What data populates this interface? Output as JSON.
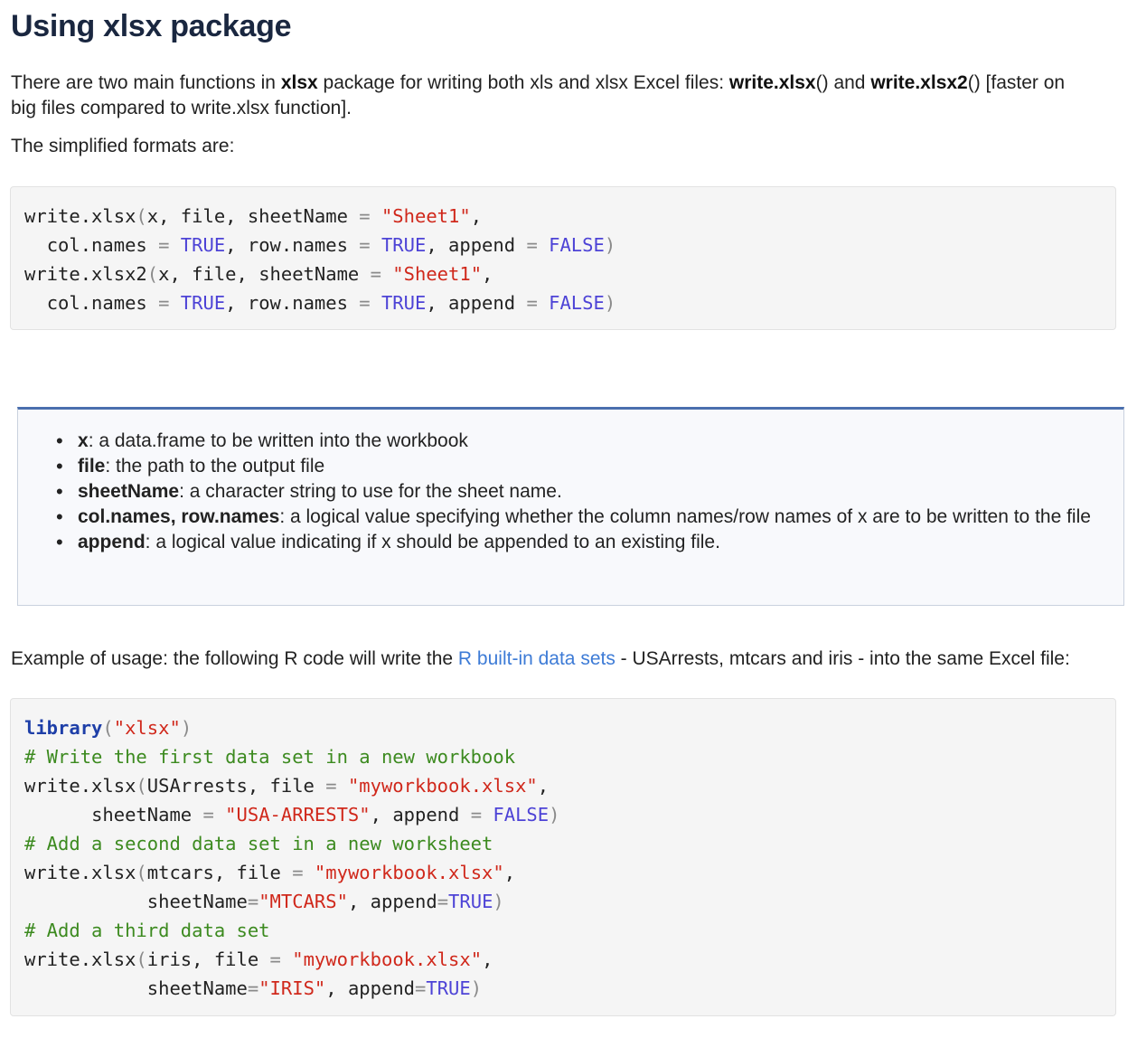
{
  "heading": "Using xlsx package",
  "intro": {
    "t1": "There are two main functions in ",
    "b1": "xlsx",
    "t2": " package for writing both xls and xlsx Excel files: ",
    "b2": "write.xlsx",
    "t3": "() and ",
    "b3": "write.xlsx2",
    "t4": "() [faster on",
    "line2": "big files compared to write.xlsx function]."
  },
  "simplified": "The simplified formats are:",
  "code1": {
    "fn1": "write.xlsx",
    "fn2": "write.xlsx2",
    "args_a": "x, file, sheetName ",
    "sheet1": "\"Sheet1\"",
    "col_names": "col.names ",
    "row_names": "row.names ",
    "append": "append ",
    "true": "TRUE",
    "false": "FALSE"
  },
  "args": [
    {
      "name": "x",
      "desc": ": a data.frame to be written into the workbook"
    },
    {
      "name": "file",
      "desc": ": the path to the output file"
    },
    {
      "name": "sheetName",
      "desc": ": a character string to use for the sheet name."
    },
    {
      "name": "col.names, row.names",
      "desc": ": a logical value specifying whether the column names/row names of x are to be written to the file"
    },
    {
      "name": "append",
      "desc": ": a logical value indicating if x should be appended to an existing file."
    }
  ],
  "example": {
    "before": "Example of usage: the following R code will write the ",
    "link": "R built-in data sets",
    "after": " - USArrests, mtcars and iris - into the same Excel file:"
  },
  "code2": {
    "library": "library",
    "pkg": "\"xlsx\"",
    "comment1": "# Write the first data set in a new workbook",
    "comment2": "# Add a second data set in a new worksheet",
    "comment3": "# Add a third data set",
    "fn": "write.xlsx",
    "file_kw": "file ",
    "wb": "\"myworkbook.xlsx\"",
    "usarrests": "USArrests, ",
    "mtcars": "mtcars, ",
    "iris": "iris, ",
    "sheetname_sp": "sheetName ",
    "sheetname": "sheetName",
    "usa": "\"USA-ARRESTS\"",
    "mtc": "\"MTCARS\"",
    "irs": "\"IRIS\"",
    "append_sp": "append ",
    "append": "append",
    "true": "TRUE",
    "false": "FALSE"
  }
}
